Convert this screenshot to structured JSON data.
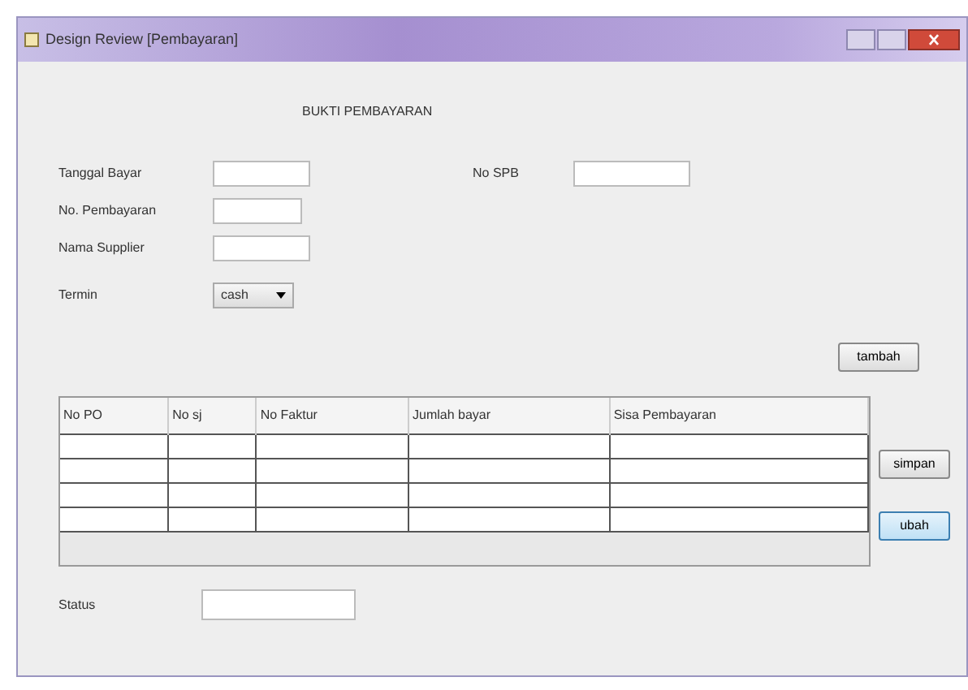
{
  "window": {
    "title": "Design Review [Pembayaran]"
  },
  "heading": "BUKTI PEMBAYARAN",
  "fields": [
    {
      "label": "Tanggal Bayar",
      "kind": "text"
    },
    {
      "label": "No SPB",
      "kind": "text"
    },
    {
      "label": "No. Pembayaran",
      "kind": "text"
    },
    {
      "label": "Nama Supplier",
      "kind": "text"
    },
    {
      "label": "Termin",
      "kind": "combo",
      "value": "cash"
    }
  ],
  "add_button": "tambah",
  "table": {
    "columns": [
      "No PO",
      "No sj",
      "No Faktur",
      "Jumlah bayar",
      "Sisa Pembayaran"
    ]
  },
  "side_buttons": [
    {
      "label": "simpan",
      "focused": false
    },
    {
      "label": "ubah",
      "focused": true
    }
  ],
  "status": {
    "label": "Status"
  }
}
